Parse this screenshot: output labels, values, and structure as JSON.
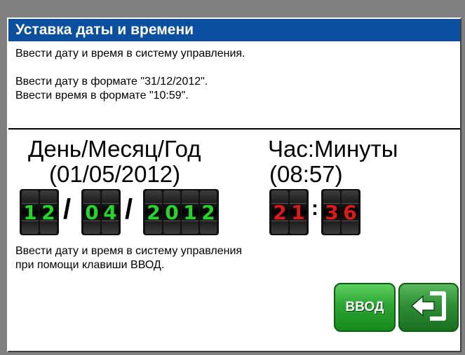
{
  "window": {
    "title": "Уставка даты и времени"
  },
  "info": {
    "line1": "Ввести дату и время в систему управления.",
    "line2": "Ввести дату в формате \"31/12/2012\".",
    "line3": "Ввести время в формате \"10:59\"."
  },
  "date": {
    "label": "День/Месяц/Год",
    "current": "(01/05/2012)",
    "day": [
      "1",
      "2"
    ],
    "month": [
      "0",
      "4"
    ],
    "year": [
      "2",
      "0",
      "1",
      "2"
    ],
    "separator": "/"
  },
  "time": {
    "label": "Час:Минуты",
    "current": "(08:57)",
    "hours": [
      "2",
      "1"
    ],
    "minutes": [
      "3",
      "6"
    ],
    "separator": ":"
  },
  "hint": {
    "line1": "Ввести дату и время в систему управления",
    "line2": "при помощи клавиши ВВОД."
  },
  "buttons": {
    "enter_label": "ВВОД",
    "exit_icon": "exit-arrow-icon"
  },
  "colors": {
    "title_bar": "#0a4fa0",
    "date_digits": "#22d62a",
    "time_digits": "#e01818",
    "button_green": "#2ca633"
  }
}
